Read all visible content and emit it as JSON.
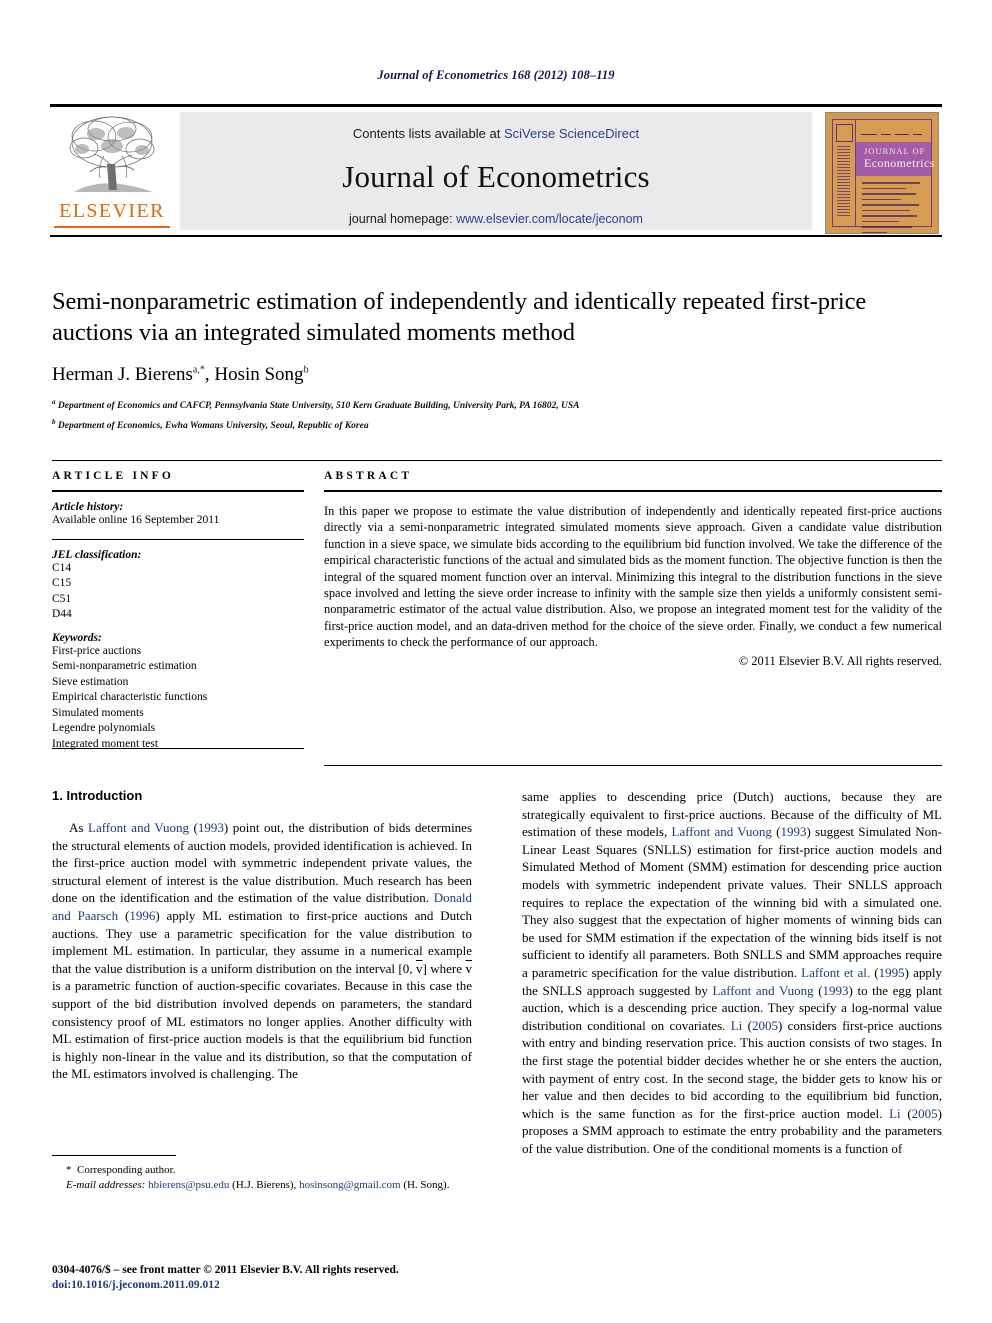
{
  "running_head": "Journal of Econometrics 168 (2012) 108–119",
  "masthead": {
    "contents_prefix": "Contents lists available at ",
    "contents_link": "SciVerse ScienceDirect",
    "journal_name": "Journal of Econometrics",
    "homepage_prefix": "journal homepage: ",
    "homepage_url": "www.elsevier.com/locate/jeconom",
    "publisher_wordmark": "ELSEVIER",
    "cover_title_line1": "JOURNAL OF",
    "cover_title_line2": "Econometrics"
  },
  "article": {
    "title": "Semi-nonparametric estimation of independently and identically repeated first-price auctions via an integrated simulated moments method",
    "authors": "Herman J. Bierens",
    "author1_sup": "a,*",
    "author2": ", Hosin Song",
    "author2_sup": "b",
    "affiliation_a_marker": "a",
    "affiliation_a": "Department of Economics and CAFCP, Pennsylvania State University, 510 Kern Graduate Building, University Park, PA 16802, USA",
    "affiliation_b_marker": "b",
    "affiliation_b": "Department of Economics, Ewha Womans University, Seoul, Republic of Korea"
  },
  "info": {
    "heading": "Article info",
    "history_label": "Article history:",
    "history_value": "Available online 16 September 2011",
    "jel_label": "JEL classification:",
    "jel_codes": [
      "C14",
      "C15",
      "C51",
      "D44"
    ],
    "keywords_label": "Keywords:",
    "keywords": [
      "First-price auctions",
      "Semi-nonparametric estimation",
      "Sieve estimation",
      "Empirical characteristic functions",
      "Simulated moments",
      "Legendre polynomials",
      "Integrated moment test"
    ]
  },
  "abstract": {
    "heading": "Abstract",
    "text": "In this paper we propose to estimate the value distribution of independently and identically repeated first-price auctions directly via a semi-nonparametric integrated simulated moments sieve approach. Given a candidate value distribution function in a sieve space, we simulate bids according to the equilibrium bid function involved. We take the difference of the empirical characteristic functions of the actual and simulated bids as the moment function. The objective function is then the integral of the squared moment function over an interval. Minimizing this integral to the distribution functions in the sieve space involved and letting the sieve order increase to infinity with the sample size then yields a uniformly consistent semi-nonparametric estimator of the actual value distribution. Also, we propose an integrated moment test for the validity of the first-price auction model, and an data-driven method for the choice of the sieve order. Finally, we conduct a few numerical experiments to check the performance of our approach.",
    "copyright": "© 2011 Elsevier B.V. All rights reserved."
  },
  "body": {
    "section_number_title": "1. Introduction",
    "left_p1_a": "As ",
    "left_p1_cite1": "Laffont and Vuong",
    "left_p1_b": " (",
    "left_p1_year1": "1993",
    "left_p1_c": ") point out, the distribution of bids determines the structural elements of auction models, provided identification is achieved. In the first-price auction model with symmetric independent private values, the structural element of interest is the value distribution. Much research has been done on the identification and the estimation of the value distribution. ",
    "left_p1_cite2": "Donald and Paarsch",
    "left_p1_d": " (",
    "left_p1_year2": "1996",
    "left_p1_e": ") apply ML estimation to first-price auctions and Dutch auctions. They use a parametric specification for the value distribution to implement ML estimation. In particular, they assume in a numerical example that the value distribution is a uniform distribution on the interval [0, ",
    "left_p1_vbar": "v",
    "left_p1_f": "] where ",
    "left_p1_vbar2": "v",
    "left_p1_g": " is a parametric function of auction-specific covariates. Because in this case the support of the bid distribution involved depends on parameters, the standard consistency proof of ML estimators no longer applies. Another difficulty with ML estimation of first-price auction models is that the equilibrium bid function is highly non-linear in the value and its distribution, so that the computation of the ML estimators involved is challenging. The",
    "right_a": "same applies to descending price (Dutch) auctions, because they are strategically equivalent to first-price auctions. Because of the difficulty of ML estimation of these models, ",
    "right_cite1": "Laffont and Vuong",
    "right_b": " (",
    "right_year1": "1993",
    "right_c": ") suggest Simulated Non-Linear Least Squares (SNLLS) estimation for first-price auction models and Simulated Method of Moment (SMM) estimation for descending price auction models with symmetric independent private values. Their SNLLS approach requires to replace the expectation of the winning bid with a simulated one. They also suggest that the expectation of higher moments of winning bids can be used for SMM estimation if the expectation of the winning bids itself is not sufficient to identify all parameters. Both SNLLS and SMM approaches require a parametric specification for the value distribution. ",
    "right_cite2": "Laffont et al.",
    "right_d": " (",
    "right_year2": "1995",
    "right_e": ") apply the SNLLS approach suggested by ",
    "right_cite3": "Laffont and Vuong",
    "right_f": " (",
    "right_year3": "1993",
    "right_g": ") to the egg plant auction, which is a descending price auction. They specify a log-normal value distribution conditional on covariates. ",
    "right_cite4": "Li",
    "right_h": " (",
    "right_year4": "2005",
    "right_i": ") considers first-price auctions with entry and binding reservation price. This auction consists of two stages. In the first stage the potential bidder decides whether he or she enters the auction, with payment of entry cost. In the second stage, the bidder gets to know his or her value and then decides to bid according to the equilibrium bid function, which is the same function as for the first-price auction model. ",
    "right_cite5": "Li",
    "right_j": " (",
    "right_year5": "2005",
    "right_k": ") proposes a SMM approach to estimate the entry probability and the parameters of the value distribution. One of the conditional moments is a function of"
  },
  "footnotes": {
    "corresponding_marker": "*",
    "corresponding_text": "Corresponding author.",
    "email_label": "E-mail addresses:",
    "email1": "hbierens@psu.edu",
    "email1_owner": " (H.J. Bierens), ",
    "email2": "hosinsong@gmail.com",
    "email2_owner": "(H. Song).",
    "issn_line": "0304-4076/$ – see front matter © 2011 Elsevier B.V. All rights reserved.",
    "doi_line": "doi:10.1016/j.jeconom.2011.09.012"
  },
  "colors": {
    "elsevier_orange": "#eb6608",
    "link_blue": "#2a3f8f",
    "citation_blue": "#1c3a86",
    "running_head_blue": "#141452",
    "cover_orange": "#d79c52",
    "cover_purple": "#a35ca8"
  }
}
